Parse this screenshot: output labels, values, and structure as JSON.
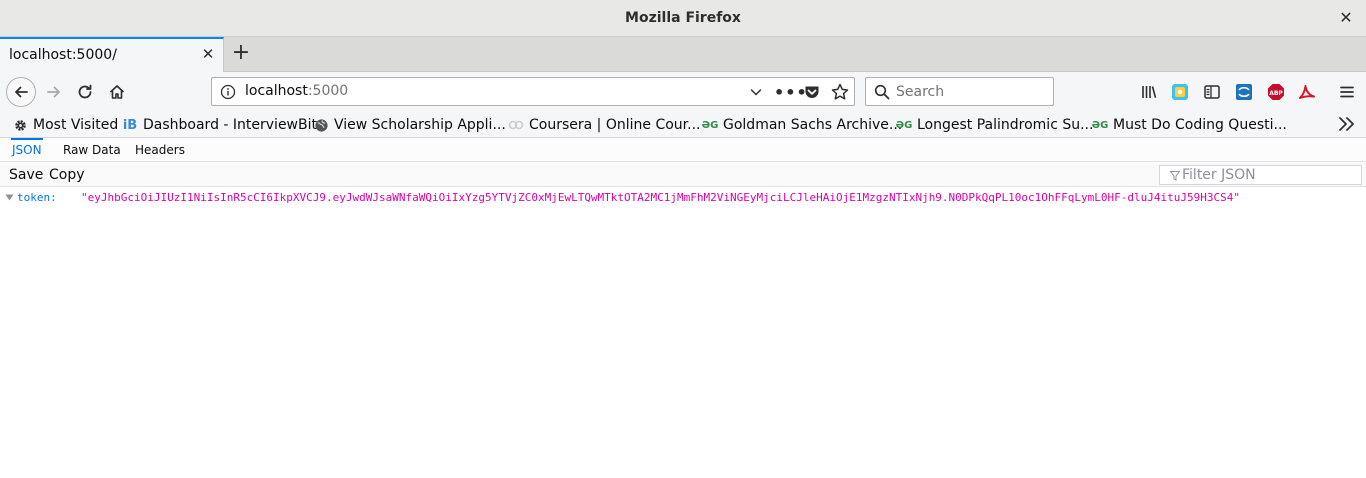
{
  "window": {
    "title": "Mozilla Firefox"
  },
  "tab": {
    "title": "localhost:5000/"
  },
  "urlbar": {
    "host": "localhost",
    "port": ":5000"
  },
  "search": {
    "placeholder": "Search"
  },
  "bookmarks": [
    {
      "label": "Most Visited",
      "icon": "gear-icon"
    },
    {
      "label": "Dashboard - InterviewBit",
      "icon": "interviewbit-icon"
    },
    {
      "label": "View Scholarship Appli...",
      "icon": "globe-icon"
    },
    {
      "label": "Coursera | Online Cour...",
      "icon": "coursera-icon"
    },
    {
      "label": "Goldman Sachs Archive...",
      "icon": "geeksforgeeks-icon"
    },
    {
      "label": "Longest Palindromic Su...",
      "icon": "geeksforgeeks-icon"
    },
    {
      "label": "Must Do Coding Questi...",
      "icon": "geeksforgeeks-icon"
    }
  ],
  "json_viewer": {
    "tabs": [
      "JSON",
      "Raw Data",
      "Headers"
    ],
    "active_tab": "JSON",
    "save_label": "Save",
    "copy_label": "Copy",
    "filter_placeholder": "Filter JSON",
    "rows": [
      {
        "key": "token:",
        "value": "\"eyJhbGciOiJIUzI1NiIsInR5cCI6IkpXVCJ9.eyJwdWJsaWNfaWQiOiIxYzg5YTVjZC0xMjEwLTQwMTktOTA2MC1jMmFhM2ViNGEyMjciLCJleHAiOjE1MzgzNTIxNjh9.N0DPkQqPL10oc1OhFFqLymL0HF-dluJ4ituJ59H3CS4\""
      }
    ]
  },
  "colors": {
    "accent": "#0a84ff",
    "json_key": "#0074e8",
    "json_string": "#dd00a9"
  }
}
